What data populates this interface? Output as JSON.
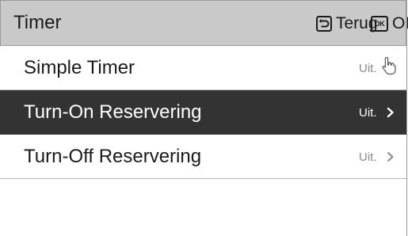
{
  "header": {
    "title": "Timer",
    "back_label": "Terug",
    "ok_icon_text": "OK",
    "ok_label": "OK",
    "back_icon": "return-arrow-icon"
  },
  "menu": {
    "items": [
      {
        "label": "Simple Timer",
        "value": "Uit.",
        "selected": false,
        "hovered": true
      },
      {
        "label": "Turn-On Reservering",
        "value": "Uit.",
        "selected": true,
        "hovered": false
      },
      {
        "label": "Turn-Off Reservering",
        "value": "Uit.",
        "selected": false,
        "hovered": false
      }
    ]
  },
  "colors": {
    "header_bg": "#c9c9c9",
    "selected_bg": "#333333",
    "value_text": "#8a8a8a",
    "divider": "#b5b5b5"
  }
}
